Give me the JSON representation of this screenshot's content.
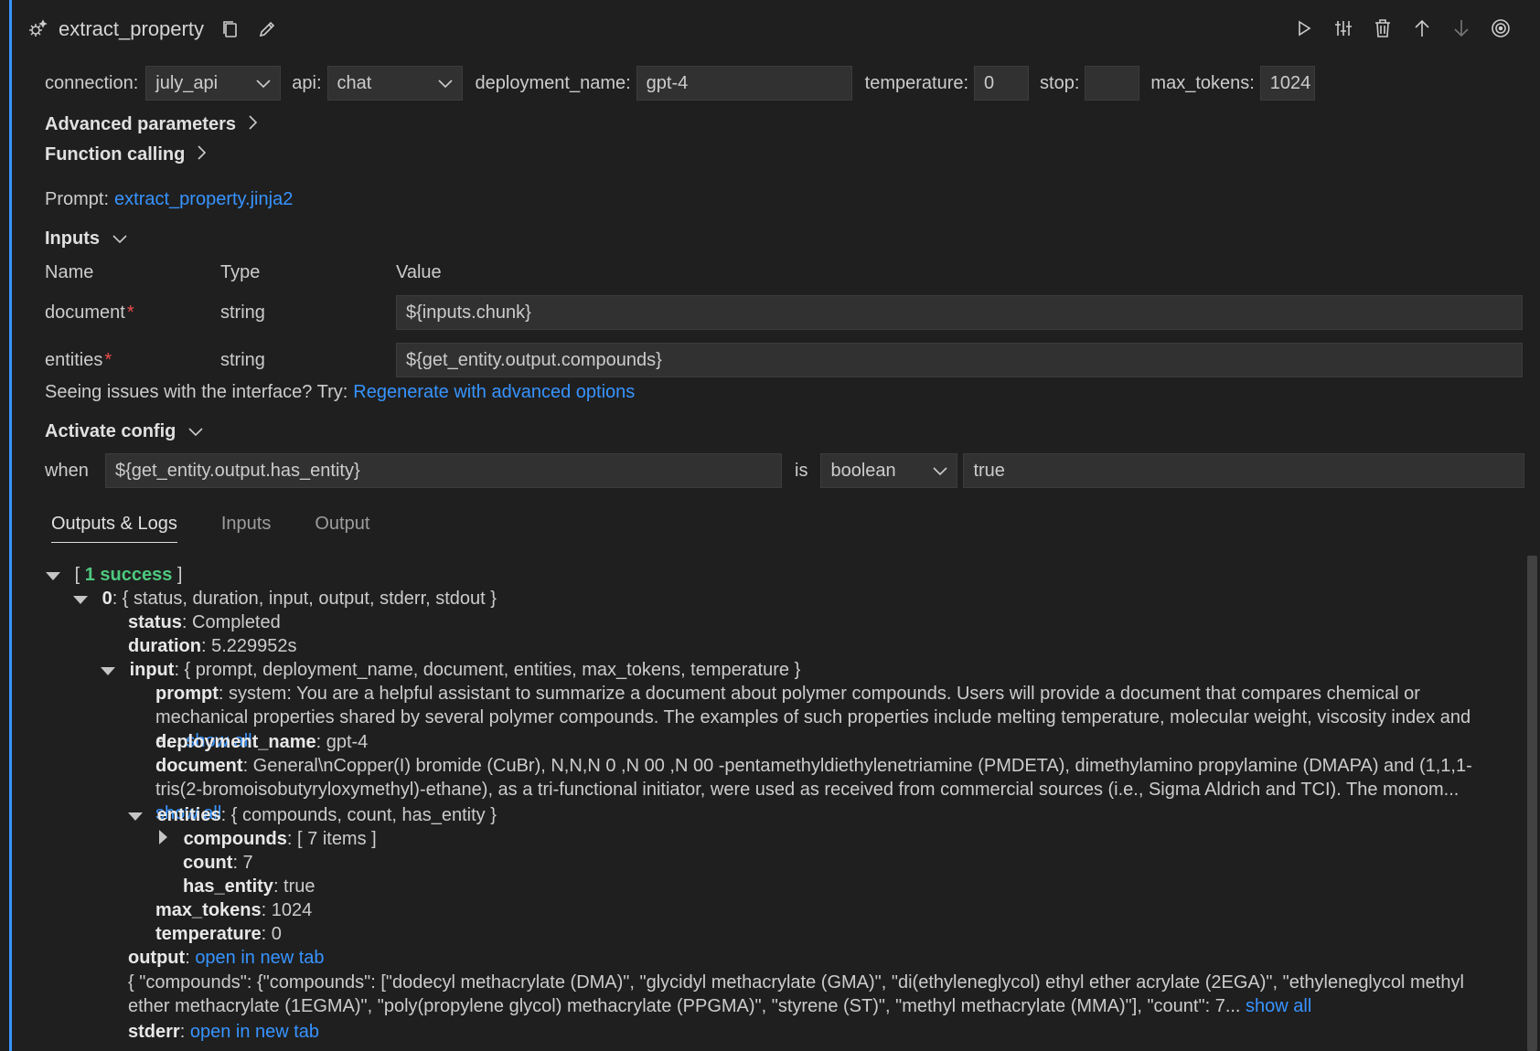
{
  "header": {
    "title": "extract_property"
  },
  "params": {
    "connection_label": "connection:",
    "connection_value": "july_api",
    "api_label": "api:",
    "api_value": "chat",
    "deployment_label": "deployment_name:",
    "deployment_value": "gpt-4",
    "temperature_label": "temperature:",
    "temperature_value": "0",
    "stop_label": "stop:",
    "stop_value": "",
    "max_tokens_label": "max_tokens:",
    "max_tokens_value": "1024"
  },
  "sections": {
    "advanced": "Advanced parameters",
    "function_calling": "Function calling",
    "inputs": "Inputs",
    "activate": "Activate config"
  },
  "prompt": {
    "label": "Prompt:",
    "file": "extract_property.jinja2"
  },
  "inputs_table": {
    "headers": [
      "Name",
      "Type",
      "Value"
    ],
    "rows": [
      {
        "name": "document",
        "type": "string",
        "value": "${inputs.chunk}"
      },
      {
        "name": "entities",
        "type": "string",
        "value": "${get_entity.output.compounds}"
      }
    ]
  },
  "issues": {
    "text": "Seeing issues with the interface? Try:",
    "link": "Regenerate with advanced options"
  },
  "activate": {
    "when_label": "when",
    "expression": "${get_entity.output.has_entity}",
    "is_label": "is",
    "type": "boolean",
    "value": "true"
  },
  "tabs": [
    "Outputs & Logs",
    "Inputs",
    "Output"
  ],
  "tree": {
    "open_bracket": "[",
    "success": "1 success",
    "close_bracket": "]",
    "item0_key": "0",
    "item0_summary": ": { status, duration, input, output, stderr, stdout }",
    "status_key": "status",
    "status_val": ": Completed",
    "duration_key": "duration",
    "duration_val": ": 5.229952s",
    "input_key": "input",
    "input_summary": ": { prompt, deployment_name, document, entities, max_tokens, temperature }",
    "prompt_key": "prompt",
    "prompt_val": ": system: You are a helpful assistant to summarize a document about polymer compounds. Users will provide a document that compares chemical or mechanical properties shared by several polymer compounds. The examples of such properties include melting temperature, molecular weight, viscosity index and e...",
    "show_all": "show all",
    "deployment_key": "deployment_name",
    "deployment_val": ": gpt-4",
    "document_key": "document",
    "document_val": ": General\\nCopper(I) bromide (CuBr), N,N,N 0 ,N 00 ,N 00 -pentamethyldiethylenetriamine (PMDETA), dimethylamino propylamine (DMAPA) and (1,1,1-tris(2-bromoisobutyryloxymethyl)-ethane), as a tri-functional initiator, were used as received from commercial sources (i.e., Sigma Aldrich and TCI). The monom...",
    "entities_key": "entities",
    "entities_summary": ": { compounds, count, has_entity }",
    "compounds_key": "compounds",
    "compounds_val": ": [ 7 items ]",
    "count_key": "count",
    "count_val": ": 7",
    "has_entity_key": "has_entity",
    "has_entity_val": ": true",
    "max_tokens_key": "max_tokens",
    "max_tokens_val": ": 1024",
    "temperature_key": "temperature",
    "temperature_val": ": 0",
    "output_key": "output",
    "output_colon": ": ",
    "open_tab": "open in new tab",
    "output_json": "{ \"compounds\": {\"compounds\": [\"dodecyl methacrylate (DMA)\", \"glycidyl methacrylate (GMA)\", \"di(ethyleneglycol) ethyl ether acrylate (2EGA)\", \"ethyleneglycol methyl ether methacrylate (1EGMA)\", \"poly(propylene glycol) methacrylate (PPGMA)\", \"styrene (ST)\", \"methyl methacrylate (MMA)\"], \"count\": 7...",
    "stderr_key": "stderr",
    "stderr_colon": ": "
  }
}
